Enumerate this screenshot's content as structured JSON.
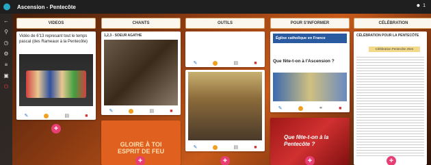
{
  "app": {
    "title": "Ascension - Pentecôte",
    "user_count": "1"
  },
  "columns": [
    {
      "label": "VIDEOS"
    },
    {
      "label": "CHANTS"
    },
    {
      "label": "OUTILS"
    },
    {
      "label": "POUR S'INFORMER"
    },
    {
      "label": "CÉLÉBRATION"
    }
  ],
  "cards": {
    "video_text": "Vidéo de 6'13 represant tout le temps pascal (des Rameaux à la Pentecôte)",
    "chant_title": "1,2,3 - SOEUR AGATHE",
    "gloire_text": "GLOIRE À TOI\nESPRIT DE FEU",
    "eglise_site": "Église catholique en France",
    "eglise_question": "Que fête-t-on à l'Ascension ?",
    "pentecote_text": "Que fête-t-on à la Pentecôte ?",
    "celebration_title": "CÉLÉBRATION POUR LA PENTECÔTE",
    "celebration_subtitle": "Célébration Pentecôte 2024"
  },
  "icons": {
    "edit": "✎",
    "delete": "🗑",
    "add": "+"
  },
  "colors": {
    "accent": "#e83e74",
    "header_border": "#d9a66a",
    "edit": "#1f6fbf",
    "delete": "#d03030"
  }
}
